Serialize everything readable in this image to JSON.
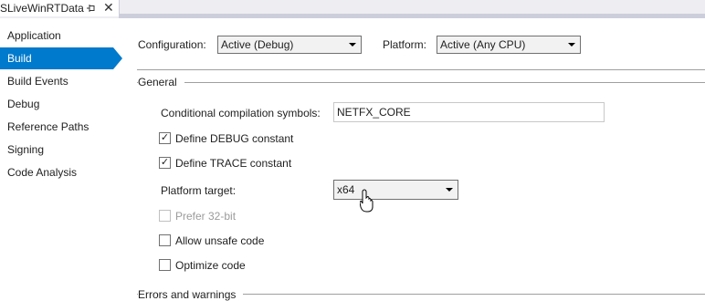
{
  "tab": {
    "title": "SLiveWinRTData"
  },
  "sidebar": {
    "items": [
      {
        "label": "Application"
      },
      {
        "label": "Build"
      },
      {
        "label": "Build Events"
      },
      {
        "label": "Debug"
      },
      {
        "label": "Reference Paths"
      },
      {
        "label": "Signing"
      },
      {
        "label": "Code Analysis"
      }
    ],
    "selected": "Build"
  },
  "config": {
    "configuration_label": "Configuration:",
    "configuration_value": "Active (Debug)",
    "platform_label": "Platform:",
    "platform_value": "Active (Any CPU)"
  },
  "general": {
    "section_title": "General",
    "symbols_label": "Conditional compilation symbols:",
    "symbols_value": "NETFX_CORE",
    "define_debug_label": "Define DEBUG constant",
    "define_debug_checked": true,
    "define_trace_label": "Define TRACE constant",
    "define_trace_checked": true,
    "platform_target_label": "Platform target:",
    "platform_target_value": "x64",
    "prefer32_label": "Prefer 32-bit",
    "prefer32_checked": false,
    "unsafe_label": "Allow unsafe code",
    "unsafe_checked": false,
    "optimize_label": "Optimize code",
    "optimize_checked": false
  },
  "errors": {
    "section_title": "Errors and warnings"
  },
  "colors": {
    "accent": "#007acc"
  }
}
